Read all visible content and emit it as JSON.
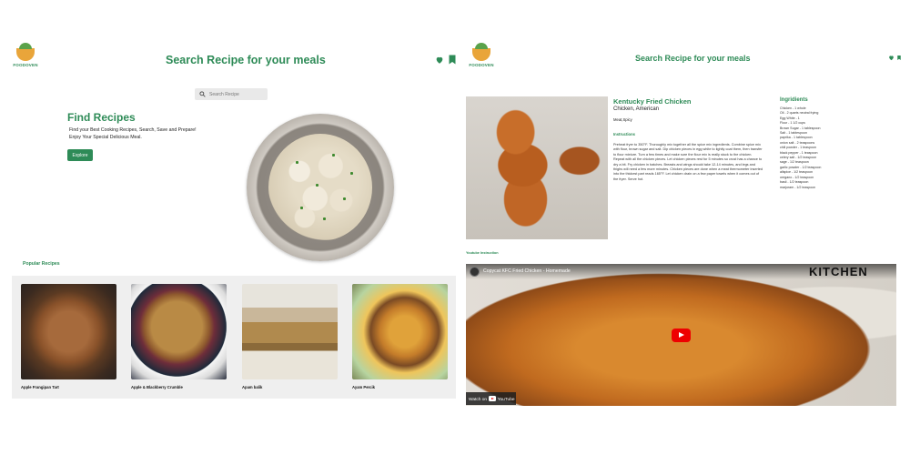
{
  "colors": {
    "accent": "#2e8b57",
    "play": "#ee0000",
    "card_bg": "#efefef"
  },
  "left": {
    "logo_text": "FOODOVEN",
    "title": "Search Recipe for your meals",
    "icons": {
      "heart": "heart-icon",
      "bookmark": "bookmark-icon",
      "search": "search-icon"
    },
    "search_placeholder": "Search Recipe",
    "hero": {
      "title": "Find Recipes",
      "line1": "Find your Best Cooking Recipes, Search, Save and Prepare!",
      "line2": "Enjoy Your Special Delicious Meal.",
      "button": "Explore"
    },
    "popular_label": "Popular Recipes",
    "cards": [
      {
        "name": "Apple Frangipan Tart"
      },
      {
        "name": "Apple & Blackberry Crumble"
      },
      {
        "name": "Apam balik"
      },
      {
        "name": "Ayam Percik"
      }
    ]
  },
  "right": {
    "logo_text": "FOODOVEN",
    "title": "Search Recipe for your meals",
    "recipe": {
      "name": "Kentucky Fried Chicken",
      "category": "Chicken, American",
      "tag": "Meat,Spicy",
      "instructions_label": "Instructions",
      "instructions": "Preheat fryer to 350°F. Thoroughly mix together all the spice mix ingredients. Combine spice mix with flour, brown sugar and salt. Dip chicken pieces in egg white to lightly coat them, then transfer to flour mixture. Turn a few times and make sure the flour mix is really stuck to the chicken. Repeat with all the chicken pieces. Let chicken pieces rest for 5 minutes so crust has a chance to dry a bit. Fry chicken in batches. Breasts and wings should take 12-14 minutes, and legs and thighs will need a few more minutes. Chicken pieces are done when a meat thermometer inserted into the thickest part reads 165°F. Let chicken drain on a few paper towels when it comes out of the fryer. Serve hot.",
      "ingredients_label": "Ingridients",
      "ingredients": [
        "Chicken - 1 whole",
        "Oil - 2 quarts neutral frying",
        "Egg White - 1",
        "Flour - 1 1/2 cups",
        "Brown Sugar - 1 tablespoon",
        "Salt - 1 tablespoon",
        "paprika - 1 tablespoon",
        "onion salt - 2 teaspoons",
        "chili powder - 1 teaspoon",
        "black pepper - 1 teaspoon",
        "celery salt - 1/2 teaspoon",
        "sage - 1/2 teaspoon",
        "garlic powder - 1/2 teaspoon",
        "allspice - 1/2 teaspoon",
        "oregano - 1/2 teaspoon",
        "basil - 1/2 teaspoon",
        "marjoram - 1/2 teaspoon"
      ],
      "youtube_label": "Youtube Instruction"
    },
    "video": {
      "title": "Copycat KFC Fried Chicken - Homemade",
      "watermark": "KITCHEN",
      "watch_on": "Watch on",
      "youtube": "YouTube"
    }
  }
}
